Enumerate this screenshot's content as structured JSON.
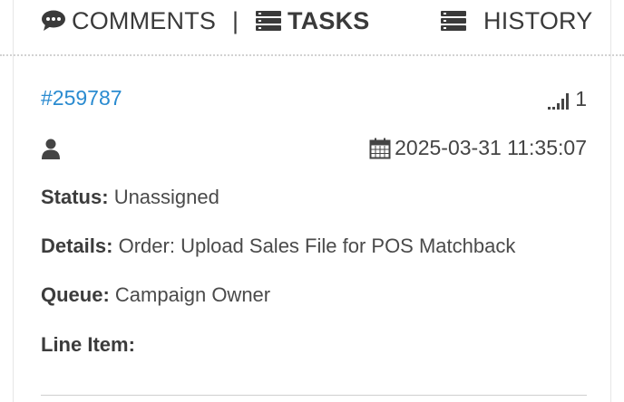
{
  "tabs": {
    "comments_label": "COMMENTS",
    "separator": "|",
    "tasks_label": "TASKS",
    "history_label": "HISTORY"
  },
  "task": {
    "id": "#259787",
    "priority": "1",
    "timestamp": "2025-03-31 11:35:07",
    "status_label": "Status:",
    "status_value": "Unassigned",
    "details_label": "Details:",
    "details_value": "Order: Upload Sales File for POS Matchback",
    "queue_label": "Queue:",
    "queue_value": "Campaign Owner",
    "line_item_label": "Line Item:",
    "line_item_value": ""
  },
  "icons": {
    "comments": "comment-icon",
    "tasks": "list-icon",
    "history": "list-icon",
    "priority": "signal-bars-icon",
    "user": "user-icon",
    "date": "calendar-icon"
  },
  "colors": {
    "link": "#2a8bd0",
    "text": "#3a3a3a"
  }
}
